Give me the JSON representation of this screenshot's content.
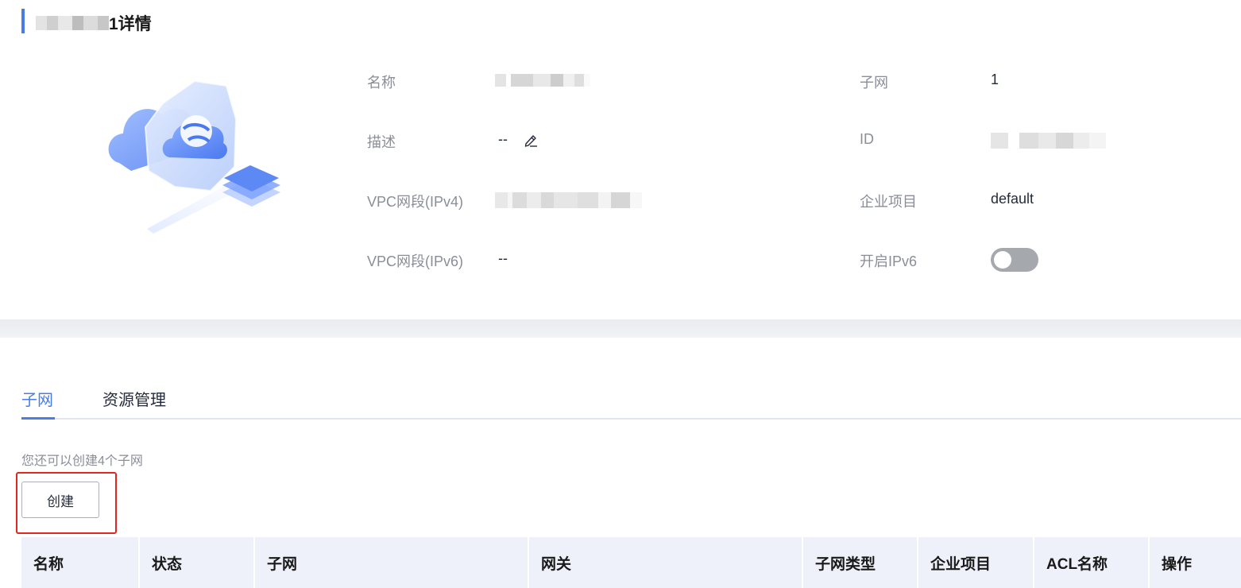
{
  "header": {
    "title_suffix": "1详情"
  },
  "details": {
    "name_label": "名称",
    "description_label": "描述",
    "description_value": "--",
    "ipv4_label": "VPC网段(IPv4)",
    "ipv6_label": "VPC网段(IPv6)",
    "ipv6_value": "--",
    "subnet_label": "子网",
    "subnet_value": "1",
    "id_label": "ID",
    "project_label": "企业项目",
    "project_value": "default",
    "enable_ipv6_label": "开启IPv6",
    "enable_ipv6_on": false
  },
  "tabs": [
    {
      "label": "子网",
      "active": true
    },
    {
      "label": "资源管理",
      "active": false
    }
  ],
  "subnet_section": {
    "quota_text": "您还可以创建4个子网",
    "create_label": "创建"
  },
  "table": {
    "columns": [
      "名称",
      "状态",
      "子网",
      "网关",
      "子网类型",
      "企业项目",
      "ACL名称",
      "操作"
    ]
  },
  "colors": {
    "accent": "#4a7ce8",
    "highlight": "#e3261f",
    "toggle_off": "#a5a8ad",
    "table_header": "#eef0fa"
  }
}
